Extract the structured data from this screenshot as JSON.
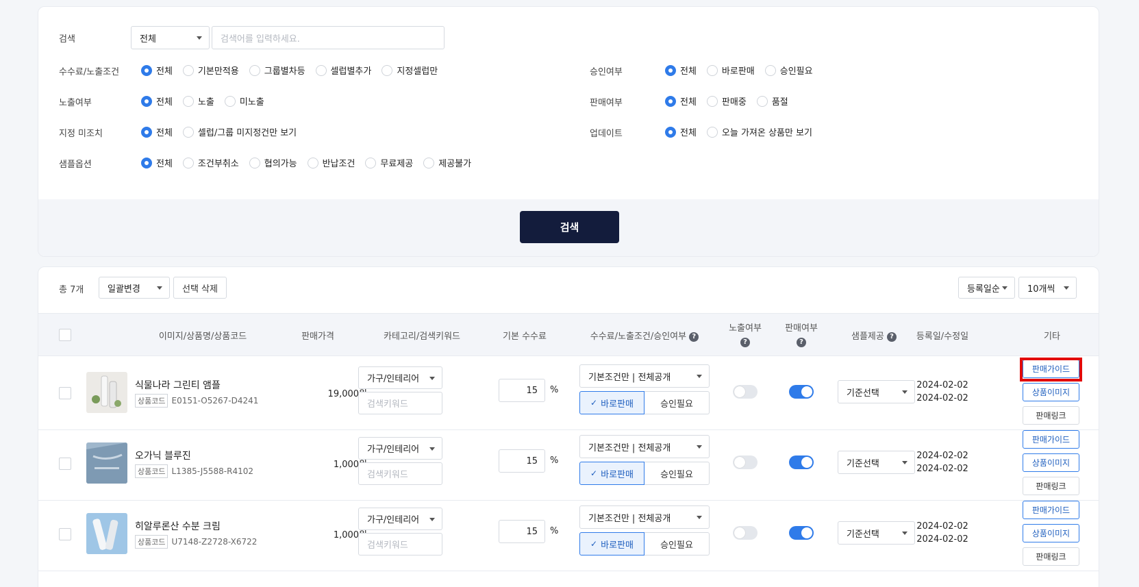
{
  "search": {
    "label": "검색",
    "scope_value": "전체",
    "placeholder": "검색어를 입력하세요.",
    "button_label": "검색"
  },
  "filters": {
    "fee_condition": {
      "label": "수수료/노출조건",
      "options": [
        "전체",
        "기본만적용",
        "그룹별차등",
        "셀럽별추가",
        "지정셀럽만"
      ],
      "selected": 0
    },
    "exposure": {
      "label": "노출여부",
      "options": [
        "전체",
        "노출",
        "미노출"
      ],
      "selected": 0
    },
    "unassigned": {
      "label": "지정 미조치",
      "options": [
        "전체",
        "셀럽/그룹 미지정건만 보기"
      ],
      "selected": 0
    },
    "sample": {
      "label": "샘플옵션",
      "options": [
        "전체",
        "조건부취소",
        "협의가능",
        "반납조건",
        "무료제공",
        "제공불가"
      ],
      "selected": 0
    },
    "approval": {
      "label": "승인여부",
      "options": [
        "전체",
        "바로판매",
        "승인필요"
      ],
      "selected": 0
    },
    "sale": {
      "label": "판매여부",
      "options": [
        "전체",
        "판매중",
        "품절"
      ],
      "selected": 0
    },
    "update": {
      "label": "업데이트",
      "options": [
        "전체",
        "오늘 가져온 상품만 보기"
      ],
      "selected": 0
    }
  },
  "list": {
    "total_label": "총 7개",
    "bulk_select": "일괄변경",
    "delete_label": "선택 삭제",
    "sort_select": "등록일순",
    "page_size_select": "10개씩",
    "columns": {
      "product": "이미지/상품명/상품코드",
      "price": "판매가격",
      "category": "카테고리/검색키워드",
      "base_fee": "기본 수수료",
      "fee_cond": "수수료/노출조건/승인여부",
      "exposure": "노출여부",
      "sale": "판매여부",
      "sample": "샘플제공",
      "dates": "등록일/수정일",
      "etc": "기타"
    },
    "help_glyph": "?",
    "code_tag": "상품코드",
    "keyword_placeholder": "검색키워드",
    "percent": "%",
    "check_glyph": "✓",
    "rows": [
      {
        "name": "식물나라 그린티 앰플",
        "code": "E0151-O5267-D4241",
        "price": "19,000원",
        "category": "가구/인테리어",
        "fee": "15",
        "condition": "기본조건만 | 전체공개",
        "approve_a": "바로판매",
        "approve_b": "승인필요",
        "exposure_on": false,
        "sale_on": true,
        "sample": "기준선택",
        "registered": "2024-02-02",
        "modified": "2024-02-02",
        "btn_guide": "판매가이드",
        "btn_image": "상품이미지",
        "btn_link": "판매링크"
      },
      {
        "name": "오가닉 블루진",
        "code": "L1385-J5588-R4102",
        "price": "1,000원",
        "category": "가구/인테리어",
        "fee": "15",
        "condition": "기본조건만 | 전체공개",
        "approve_a": "바로판매",
        "approve_b": "승인필요",
        "exposure_on": false,
        "sale_on": true,
        "sample": "기준선택",
        "registered": "2024-02-02",
        "modified": "2024-02-02",
        "btn_guide": "판매가이드",
        "btn_image": "상품이미지",
        "btn_link": "판매링크"
      },
      {
        "name": "히알루론산 수분 크림",
        "code": "U7148-Z2728-X6722",
        "price": "1,000원",
        "category": "가구/인테리어",
        "fee": "15",
        "condition": "기본조건만 | 전체공개",
        "approve_a": "바로판매",
        "approve_b": "승인필요",
        "exposure_on": false,
        "sale_on": true,
        "sample": "기준선택",
        "registered": "2024-02-02",
        "modified": "2024-02-02",
        "btn_guide": "판매가이드",
        "btn_image": "상품이미지",
        "btn_link": "판매링크"
      }
    ]
  },
  "colors": {
    "accent": "#2f7be9",
    "search_button": "#131c3c",
    "highlight": "#e20a0a"
  }
}
